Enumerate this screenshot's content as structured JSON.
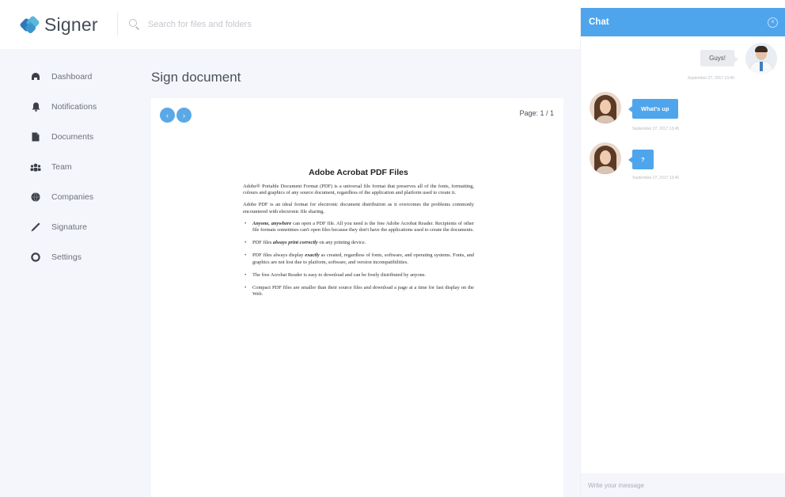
{
  "app": {
    "name": "Signer"
  },
  "search": {
    "placeholder": "Search for files and folders"
  },
  "sidebar": {
    "items": [
      {
        "label": "Dashboard",
        "icon": "dashboard-icon"
      },
      {
        "label": "Notifications",
        "icon": "bell-icon"
      },
      {
        "label": "Documents",
        "icon": "document-icon"
      },
      {
        "label": "Team",
        "icon": "team-icon"
      },
      {
        "label": "Companies",
        "icon": "globe-icon"
      },
      {
        "label": "Signature",
        "icon": "pen-icon"
      },
      {
        "label": "Settings",
        "icon": "gear-icon"
      }
    ]
  },
  "main": {
    "title": "Sign document",
    "pager": {
      "prev": "‹",
      "next": "›",
      "page_label": "Page: 1 / 1"
    }
  },
  "pdf": {
    "title": "Adobe Acrobat PDF Files",
    "paragraphs": [
      "Adobe® Portable Document Format (PDF) is a universal file format that preserves all of the fonts, formatting, colours and graphics of any source document, regardless of the application and platform used to create it.",
      "Adobe PDF is an ideal format for electronic document distribution as it overcomes the problems commonly encountered with electronic file sharing."
    ],
    "bullets": [
      {
        "lead": "Anyone, anywhere",
        "text": " can open a PDF file. All you need is the free Adobe Acrobat Reader. Recipients of other file formats sometimes can't open files because they don't have the applications used to create the documents."
      },
      {
        "pre": "PDF files ",
        "lead": "always print correctly",
        "text": " on any printing device."
      },
      {
        "pre": "PDF files always display ",
        "lead": "exactly",
        "text": " as created, regardless of fonts, software, and operating systems. Fonts, and graphics are not lost due to platform, software, and version incompatibilities."
      },
      {
        "text": "The free Acrobat Reader is easy to download and can be freely distributed by anyone."
      },
      {
        "text": "Compact PDF files are smaller than their source files and download a page at a time for fast display on the Web."
      }
    ]
  },
  "chat": {
    "title": "Chat",
    "close_icon": "close-icon",
    "messages": [
      {
        "direction": "out",
        "text": "Guys!",
        "time": "September 27, 2017 13:40"
      },
      {
        "direction": "in",
        "text": "What's up",
        "time": "September 27, 2017 13:45"
      },
      {
        "direction": "in",
        "text": "?",
        "time": "September 27, 2017 13:46"
      }
    ],
    "input_placeholder": "Write your message"
  },
  "colors": {
    "accent": "#4fa5ec",
    "sidebar_bg": "#f4f6fb"
  }
}
